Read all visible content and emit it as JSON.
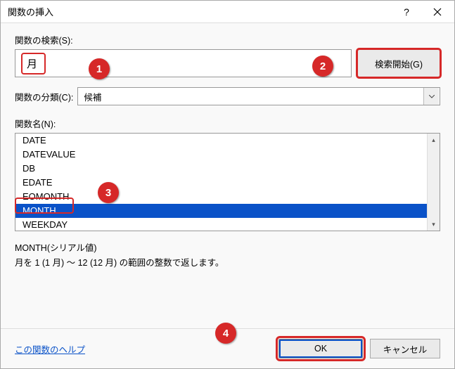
{
  "titlebar": {
    "title": "関数の挿入"
  },
  "search": {
    "label": "関数の検索(S):",
    "value": "月",
    "button": "検索開始(G)"
  },
  "category": {
    "label": "関数の分類(C):",
    "value": "候補"
  },
  "funclist": {
    "label": "関数名(N):",
    "items": [
      "DATE",
      "DATEVALUE",
      "DB",
      "EDATE",
      "EOMONTH",
      "MONTH",
      "WEEKDAY"
    ],
    "selected": "MONTH"
  },
  "description": {
    "signature": "MONTH(シリアル値)",
    "text": "月を 1 (1 月) ～ 12 (12 月) の範囲の整数で返します。"
  },
  "footer": {
    "help": "この関数のヘルプ",
    "ok": "OK",
    "cancel": "キャンセル"
  },
  "badges": {
    "b1": "1",
    "b2": "2",
    "b3": "3",
    "b4": "4"
  }
}
